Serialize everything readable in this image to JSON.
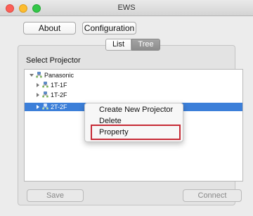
{
  "window": {
    "title": "EWS"
  },
  "toolbar": {
    "about_label": "About",
    "configuration_label": "Configuration"
  },
  "view_toggle": {
    "options": [
      "List",
      "Tree"
    ],
    "selected": "Tree"
  },
  "section": {
    "label": "Select Projector"
  },
  "tree": {
    "root": {
      "label": "Panasonic",
      "icon": "network-icon",
      "expanded": true
    },
    "children": [
      {
        "label": "1T-1F",
        "icon": "network-icon",
        "expanded": false,
        "selected": false
      },
      {
        "label": "1T-2F",
        "icon": "network-icon",
        "expanded": false,
        "selected": false
      },
      {
        "label": "2T-2F",
        "icon": "network-icon",
        "expanded": false,
        "selected": true
      }
    ]
  },
  "context_menu": {
    "items": [
      "Create New Projector",
      "Delete",
      "Property"
    ],
    "highlighted": "Property"
  },
  "footer": {
    "save_label": "Save",
    "connect_label": "Connect"
  },
  "colors": {
    "selection": "#3c7fd9",
    "highlight_border": "#c62a35"
  }
}
